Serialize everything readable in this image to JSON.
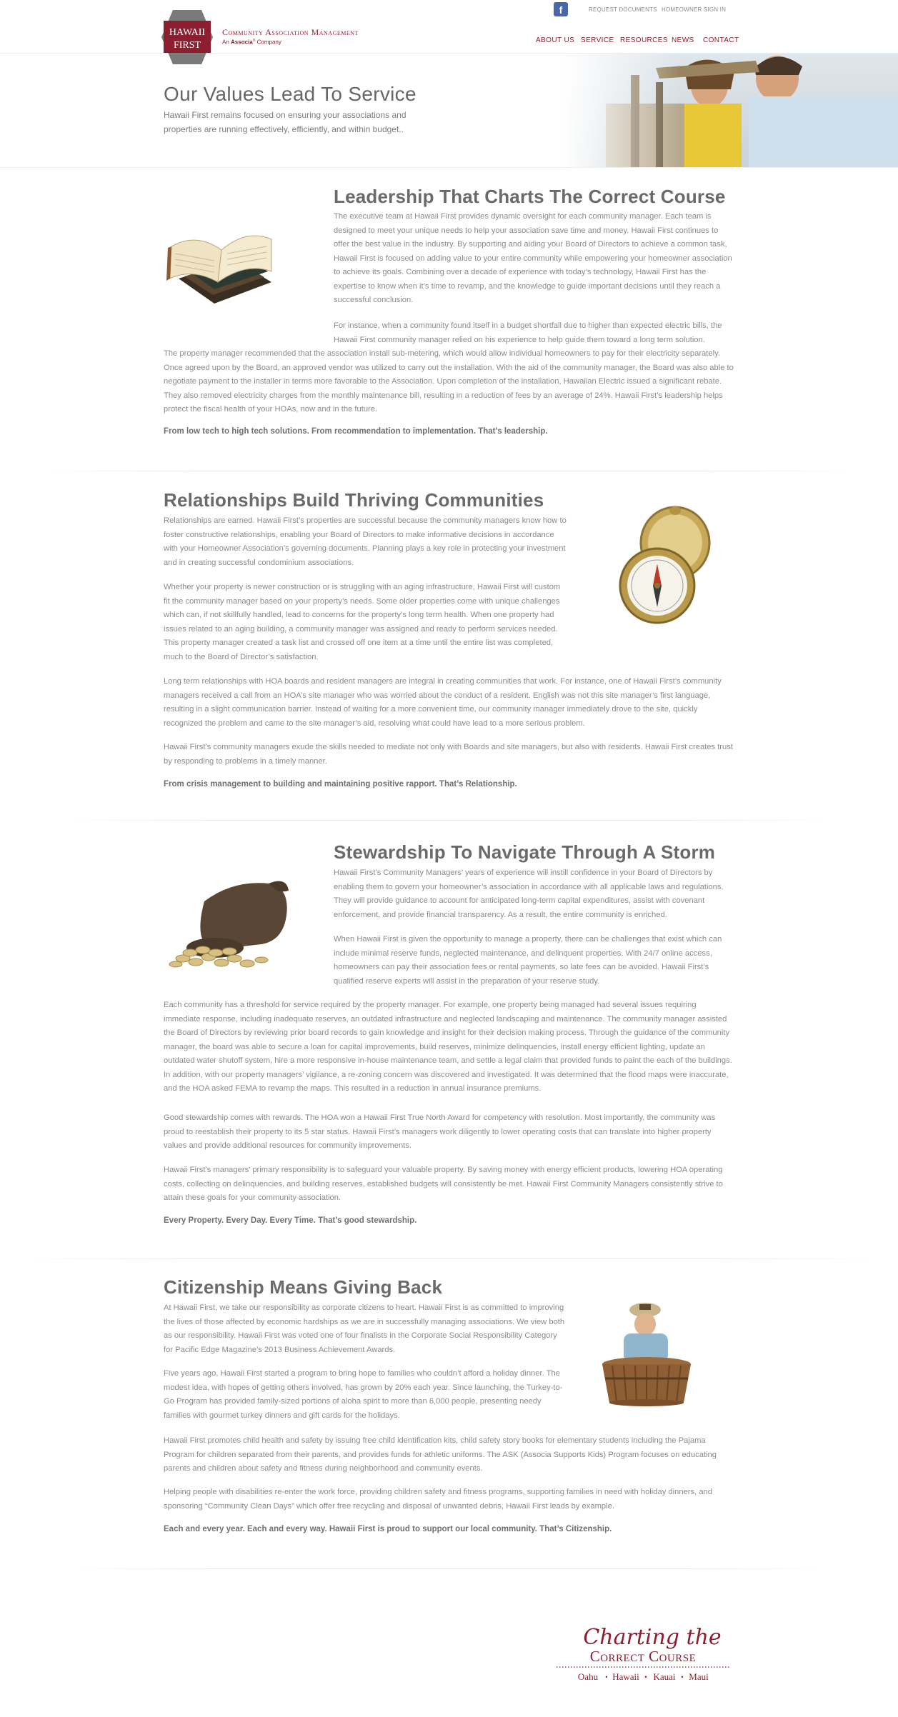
{
  "header": {
    "logo_text_line1": "HAWAII",
    "logo_text_line2": "FIRST",
    "brand_line1": "Community Association Management",
    "brand_line2_prefix": "An",
    "brand_line2_brand": "Associa",
    "brand_line2_suffix": "Company",
    "facebook_glyph": "f",
    "top_links": [
      "REQUEST DOCUMENTS",
      "HOMEOWNER SIGN IN"
    ],
    "nav": [
      "ABOUT US",
      "SERVICE",
      "RESOURCES",
      "NEWS",
      "CONTACT"
    ]
  },
  "hero": {
    "title": "Our Values Lead To Service",
    "subtitle": "Hawaii First remains focused on ensuring your associations and properties are running effectively, efficiently, and within budget.."
  },
  "leadership": {
    "title": "Leadership That Charts The Correct Course",
    "p1": "The executive team at Hawaii First provides dynamic oversight for each community manager. Each team is designed to meet your unique needs to help your association save time and money. Hawaii First continues to offer the best value in the industry. By supporting and aiding your Board of Directors to achieve a common task, Hawaii First is focused on adding value to your entire community while empowering your homeowner association to achieve its goals. Combining over a decade of experience with today’s technology, Hawaii First has the expertise to know when it’s time to revamp, and the knowledge to guide important decisions until they reach a successful conclusion.",
    "p2a": "For instance, when a community found itself in a budget shortfall due to higher than expected electric bills, the Hawaii First community manager relied on his experience to help guide them toward a long term solution.",
    "p2b": "The property manager recommended that the association install sub-metering, which would allow individual homeowners to pay for their electricity separately. Once agreed upon by the Board, an approved vendor was utilized to carry out the installation. With the aid of the community manager, the Board was also able to negotiate payment to the installer in terms more favorable to the Association. Upon completion of the installation, Hawaiian Electric issued a significant rebate. They also removed electricity charges from the monthly maintenance bill, resulting in a reduction of fees by an average of 24%. Hawaii First’s leadership helps protect the fiscal health of your HOAs, now and in the future.",
    "tagline": "From low tech to high tech solutions. From recommendation to implementation. That’s leadership."
  },
  "relationships": {
    "title": "Relationships Build Thriving Communities",
    "p1": "Relationships are earned. Hawaii First’s properties are successful because the community managers know how to foster constructive relationships, enabling your Board of Directors to make informative decisions in accordance with your Homeowner Association’s governing documents. Planning plays a key role in protecting your investment and in creating successful condominium associations.",
    "p2": "Whether your property is newer construction or is struggling with an aging infrastructure, Hawaii First will custom fit the community manager based on your property’s needs. Some older properties come with unique challenges which can, if not skillfully handled, lead to concerns for the property’s long term health. When one property had issues related to an aging building, a community manager was assigned and ready to perform services needed. This property manager created a task list and crossed off one item at a time until the entire list was completed, much to the Board of Director’s satisfaction.",
    "p3": "Long term relationships with HOA boards and resident managers are integral in creating communities that work. For instance, one of Hawaii First’s community managers received a call from an HOA’s site manager who was worried about the conduct of a resident. English was not this site manager’s first language, resulting in a slight communication barrier. Instead of waiting for a more convenient time, our community manager immediately drove to the site, quickly recognized the problem and came to the site manager’s aid, resolving what could have lead to a more serious problem.",
    "p4": "Hawaii First’s community managers exude the skills needed to mediate not only with Boards and site managers, but also with residents. Hawaii First creates trust by responding to problems in a timely manner.",
    "tagline": "From crisis management to building and maintaining positive rapport. That’s Relationship."
  },
  "stewardship": {
    "title": "Stewardship To Navigate Through A Storm",
    "p1": "Hawaii First’s Community Managers’ years of experience will instill confidence in your Board of Directors by enabling them to govern your homeowner’s association in accordance with all applicable laws and regulations. They will provide guidance to account for anticipated long-term capital expenditures, assist with covenant enforcement, and provide financial transparency. As a result, the entire community is enriched.",
    "p2": "When Hawaii First is given the opportunity to manage a property, there can be challenges that exist which can include minimal reserve funds, neglected maintenance, and delinquent properties. With 24/7 online access, homeowners can pay their association fees or rental payments, so late fees can be avoided. Hawaii First’s qualified reserve experts will assist in the preparation of your reserve study.",
    "p3": "Each community has a threshold for service required by the property manager. For example, one property being managed had several issues requiring immediate response, including inadequate reserves, an outdated infrastructure and neglected landscaping and maintenance. The community manager assisted the Board of Directors by reviewing prior board records to gain knowledge and insight for their decision making process. Through the guidance of the community manager, the board was able to secure a loan for capital improvements, build reserves, minimize delinquencies, install energy efficient lighting, update an outdated water shutoff system, hire a more responsive in-house maintenance team, and settle a legal claim that provided funds to paint the each of the buildings. In addition, with our property managers’ vigilance, a re-zoning concern was discovered and investigated. It was determined that the flood maps were inaccurate, and the HOA asked FEMA to revamp the maps. This resulted in a reduction in annual insurance premiums.",
    "p4": "Good stewardship comes with rewards. The HOA won a Hawaii First True North Award for competency with resolution. Most importantly, the community was proud to reestablish their property to its 5 star status. Hawaii First’s managers work diligently to lower operating costs that can translate into higher property values and provide additional resources for community improvements.",
    "p5": "Hawaii First’s managers’ primary responsibility is to safeguard your valuable property. By saving money with energy efficient products, lowering HOA operating costs, collecting on delinquencies, and building reserves, established budgets will consistently be met. Hawaii First Community Managers consistently strive to attain these goals for your community association.",
    "tagline": "Every Property. Every Day. Every Time. That’s good stewardship."
  },
  "citizenship": {
    "title": "Citizenship Means Giving Back",
    "p1": "At Hawaii First, we take our responsibility as corporate citizens to heart. Hawaii First is as committed to improving the lives of those affected by economic hardships as we are in successfully managing associations. We view both as our responsibility. Hawaii First was voted one of four finalists in the Corporate Social Responsibility Category for Pacific Edge Magazine’s 2013 Business Achievement Awards.",
    "p2": "Five years ago, Hawaii First started a program to bring hope to families who couldn’t afford a holiday dinner. The modest idea, with hopes of getting others involved, has grown by 20% each year. Since launching, the Turkey-to-Go Program has provided family-sized portions of aloha spirit to more than 6,000 people, presenting needy families with gourmet turkey dinners and gift cards for the holidays.",
    "p3": "Hawaii First promotes child health and safety by issuing free child identification kits, child safety story books for elementary students including the Pajama Program for children separated from their parents, and provides funds for athletic uniforms. The ASK (Associa Supports Kids) Program focuses on educating parents and children about safety and fitness during neighborhood and community events.",
    "p4": "Helping people with disabilities re-enter the work force, providing children safety and fitness programs, supporting families in need with holiday dinners, and sponsoring “Community Clean Days” which offer free recycling and disposal of unwanted debris, Hawaii First leads by example.",
    "tagline": "Each and every year. Each and every way. Hawaii First is proud to support our local community. That’s Citizenship."
  },
  "footer": {
    "script_line": "Charting the",
    "caps_line": "Correct Course",
    "islands": [
      "Oahu",
      "Hawaii",
      "Kauai",
      "Maui"
    ]
  },
  "colors": {
    "brand": "#8c1e2f",
    "text": "#8a8a8a",
    "heading": "#6a6a6a"
  }
}
